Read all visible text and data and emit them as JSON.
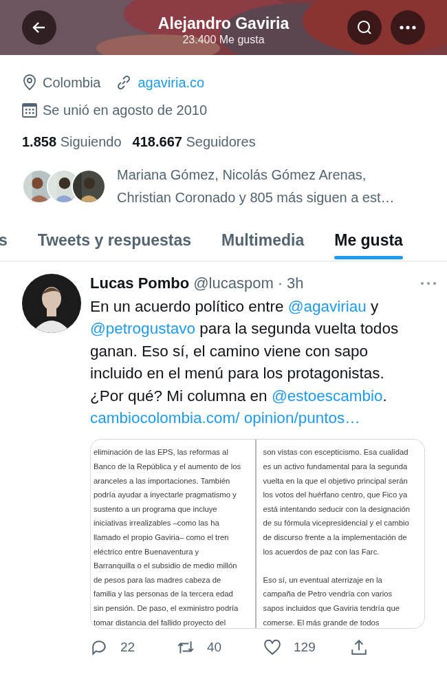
{
  "header": {
    "title": "Alejandro Gaviria",
    "subtitle": "23.400 Me gusta"
  },
  "profile": {
    "location": "Colombia",
    "website": "agaviria.co",
    "joined": "Se unió en agosto de 2010",
    "following_count": "1.858",
    "following_label": "Siguiendo",
    "followers_count": "418.667",
    "followers_label": "Seguidores",
    "followers_you_know": "Mariana Gómez, Nicolás Gómez Arenas, Christian Coronado y 805 más siguen a est…"
  },
  "tabs": [
    {
      "label": "s",
      "selected": false
    },
    {
      "label": "Tweets y respuestas",
      "selected": false
    },
    {
      "label": "Multimedia",
      "selected": false
    },
    {
      "label": "Me gusta",
      "selected": true
    }
  ],
  "tweet": {
    "author": "Lucas Pombo",
    "handle": "@lucaspom",
    "separator": "·",
    "time": "3h",
    "segments": [
      {
        "kind": "text",
        "text": "En un acuerdo político entre "
      },
      {
        "kind": "link",
        "text": "@agaviriau"
      },
      {
        "kind": "text",
        "text": " y "
      },
      {
        "kind": "link",
        "text": "@petrogustavo"
      },
      {
        "kind": "text",
        "text": " para la segunda vuelta todos ganan. Eso sí, el camino viene con sapo incluido en el menú para los protagonistas. ¿Por qué?  Mi columna en "
      },
      {
        "kind": "link",
        "text": "@estoescambio"
      },
      {
        "kind": "text",
        "text": ". "
      },
      {
        "kind": "link",
        "text": "cambiocolombia.com/ opinion/puntos…"
      }
    ],
    "document": {
      "columns": [
        [
          "eliminación de las EPS, las reformas al",
          "Banco de la República y el aumento de los",
          "aranceles a las importaciones. También",
          "podría ayudar a inyectarle pragmatismo y",
          "sustento a un programa que incluye",
          "iniciativas irrealizables –como las ha",
          "llamado el propio Gaviria– como el tren",
          "eléctrico entre Buenaventura y",
          "Barranquilla o el subsidio de medio millón",
          "de pesos para las madres cabeza de",
          "familia y las personas de la tercera edad",
          "sin pensión. De paso, el exministro podría",
          "tomar distancia del fallido proyecto del"
        ],
        [
          "son vistas con escepticismo. Esa cualidad",
          "es un activo fundamental para la segunda",
          "vuelta en la que el objetivo principal serán",
          "los votos del huérfano centro, que Fico ya",
          "está intentando seducir con la designación",
          "de su fórmula vicepresidencial y el cambio",
          "de discurso frente a la implementación de",
          "los acuerdos de paz con las Farc.",
          "",
          "Eso sí, un eventual aterrizaje en la",
          "campaña de Petro vendría con varios",
          "sapos incluidos que Gaviria tendría que",
          "comerse. El más grande de todos"
        ]
      ]
    },
    "actions": [
      {
        "kind": "reply",
        "count": "22"
      },
      {
        "kind": "retweet",
        "count": "40"
      },
      {
        "kind": "like",
        "count": "129"
      },
      {
        "kind": "share"
      }
    ]
  }
}
